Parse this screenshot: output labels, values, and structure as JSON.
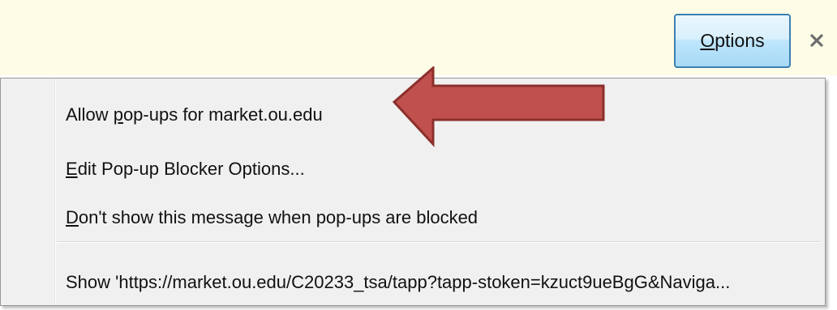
{
  "notification_bar": {
    "options_button": {
      "access_key": "O",
      "label_rest": "ptions"
    },
    "close_icon": "close-x-icon",
    "background_color": "#fdfce6"
  },
  "menu": {
    "items": [
      {
        "prefix": "Allow ",
        "access_key": "p",
        "rest": "op-ups for market.ou.edu"
      },
      {
        "prefix": "",
        "access_key": "E",
        "rest": "dit Pop-up Blocker Options..."
      },
      {
        "prefix": "",
        "access_key": "D",
        "rest": "on't show this message when pop-ups are blocked"
      },
      {
        "prefix": "",
        "access_key": "",
        "rest": "Show 'https://market.ou.edu/C20233_tsa/tapp?tapp-stoken=kzuct9ueBgG&Naviga..."
      }
    ]
  },
  "annotation": {
    "arrow_color": "#c0504d",
    "arrow_outline": "#8c2f2c",
    "icon": "left-pointing-arrow"
  }
}
